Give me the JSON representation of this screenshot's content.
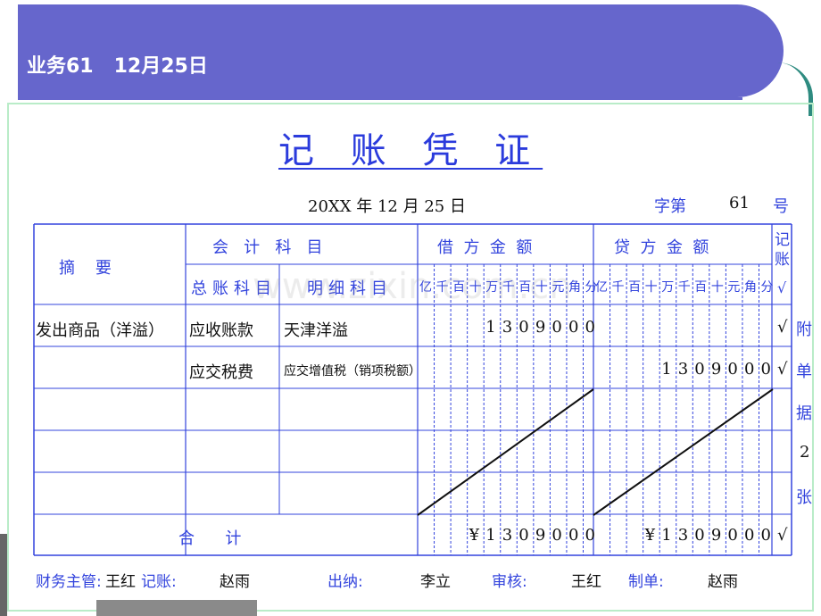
{
  "header": {
    "business": "业务61",
    "date": "12月25日"
  },
  "voucher": {
    "title": "记 账 凭 证",
    "date_line": "20XX 年 12 月 25 日",
    "number_prefix": "字第",
    "number": "61",
    "number_suffix": "号"
  },
  "table": {
    "col_summary": "摘    要",
    "col_accounts": "会   计   科   目",
    "col_general": "总账科目",
    "col_detail": "明细科目",
    "col_debit": "借  方  金  额",
    "col_credit": "贷  方  金  额",
    "col_posted": "记账",
    "posted_mark": "√",
    "units_debit": [
      "亿",
      "千",
      "百",
      "十",
      "万",
      "千",
      "百",
      "十",
      "元",
      "角",
      "分"
    ],
    "units_credit": [
      "亿",
      "千",
      "百",
      "十",
      "万",
      "千",
      "百",
      "十",
      "元",
      "角",
      "分"
    ],
    "rows": [
      {
        "summary": "发出商品（洋溢）",
        "general": "应收账款",
        "detail": "天津洋溢",
        "debit": [
          "",
          "",
          "",
          "",
          "1",
          "3",
          "0",
          "9",
          "0",
          "0",
          "0"
        ],
        "credit": [
          "",
          "",
          "",
          "",
          "",
          "",
          "",
          "",
          "",
          "",
          ""
        ],
        "posted": "√"
      },
      {
        "summary": "",
        "general": "应交税费",
        "detail": "应交增值税（销项税额）",
        "debit": [
          "",
          "",
          "",
          "",
          "",
          "",
          "",
          "",
          "",
          "",
          ""
        ],
        "credit": [
          "",
          "",
          "",
          "",
          "1",
          "3",
          "0",
          "9",
          "0",
          "0",
          "0"
        ],
        "posted": "√"
      }
    ],
    "total_label": "合      计",
    "total_debit": [
      "",
      "",
      "",
      "¥",
      "1",
      "3",
      "0",
      "9",
      "0",
      "0",
      "0"
    ],
    "total_credit": [
      "",
      "",
      "",
      "¥",
      "1",
      "3",
      "0",
      "9",
      "0",
      "0",
      "0"
    ],
    "total_posted": "√",
    "attachment": [
      "附",
      "单",
      "据",
      "2",
      "张"
    ]
  },
  "footer": {
    "supervisor_label": "财务主管:",
    "supervisor": "王红",
    "bookkeeper_label": "记账:",
    "bookkeeper": "赵雨",
    "cashier_label": "出纳:",
    "cashier": "李立",
    "auditor_label": "审核:",
    "auditor": "王红",
    "preparer_label": "制单:",
    "preparer": "赵雨"
  },
  "watermark": "www.zixin.com.cn"
}
